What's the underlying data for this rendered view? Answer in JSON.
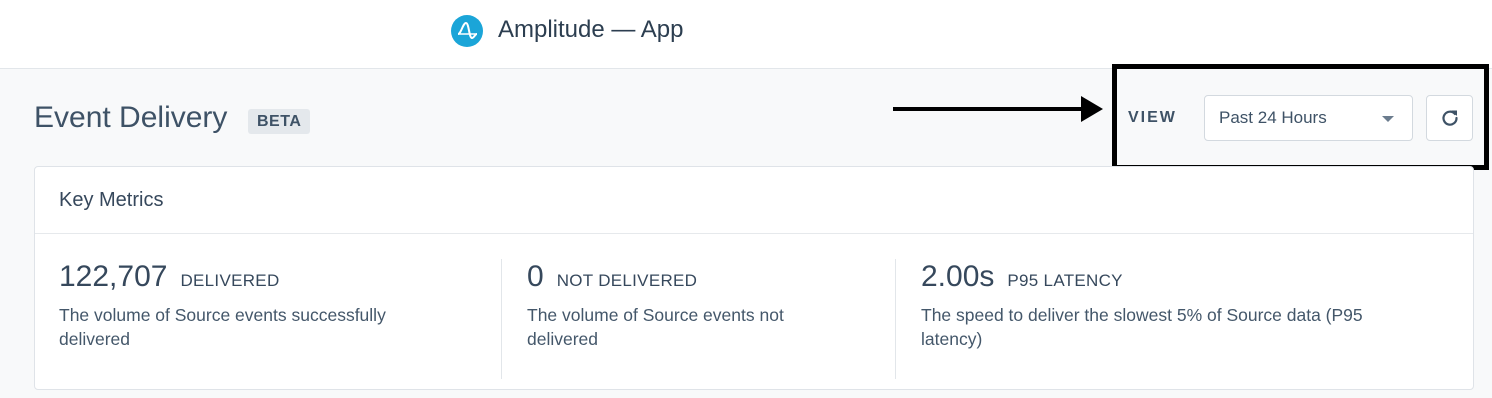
{
  "app": {
    "title": "Amplitude — App",
    "logo_icon": "amplitude-logo-icon",
    "logo_color": "#1ba5d8"
  },
  "page": {
    "title": "Event Delivery",
    "badge": "BETA"
  },
  "view": {
    "label": "VIEW",
    "selected": "Past 24 Hours",
    "refresh_icon": "refresh-icon"
  },
  "card": {
    "title": "Key Metrics",
    "metrics": [
      {
        "value": "122,707",
        "label": "DELIVERED",
        "description_line1": "The volume of Source events successfully",
        "description_line2": "delivered"
      },
      {
        "value": "0",
        "label": "NOT DELIVERED",
        "description_line1": "The volume of Source events not",
        "description_line2": "delivered"
      },
      {
        "value": "2.00s",
        "label": "P95 LATENCY",
        "description_line1": "The speed to deliver the slowest 5% of Source data (P95",
        "description_line2": "latency)"
      }
    ]
  },
  "annotation": {
    "arrow_icon": "right-arrow-icon",
    "box_color": "#000000"
  }
}
